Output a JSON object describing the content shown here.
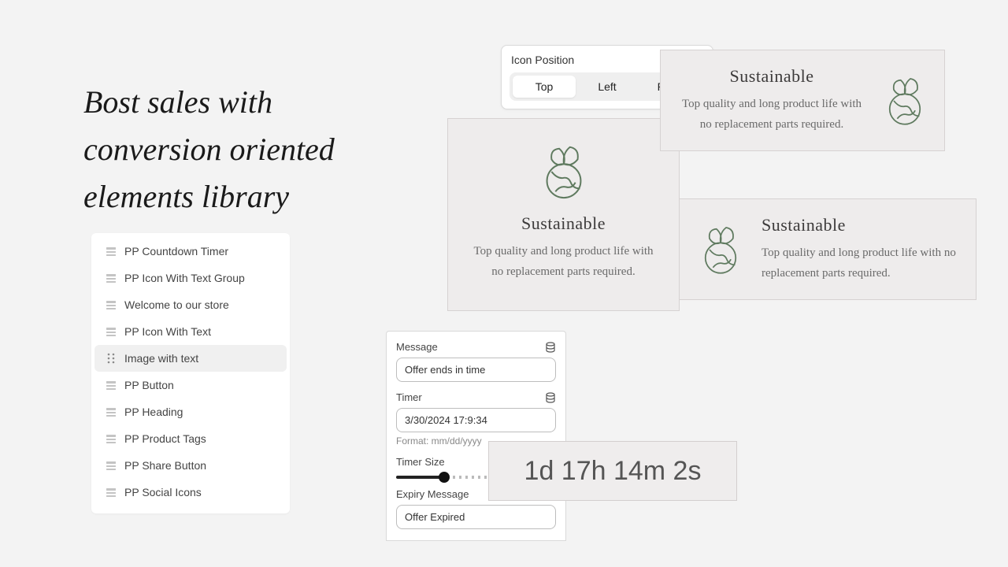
{
  "headline": "Bost sales with conversion oriented elements library",
  "elements": [
    {
      "label": "PP Countdown Timer",
      "active": false,
      "drag": false
    },
    {
      "label": "PP Icon With Text Group",
      "active": false,
      "drag": false
    },
    {
      "label": "Welcome to our store",
      "active": false,
      "drag": false
    },
    {
      "label": "PP Icon With Text",
      "active": false,
      "drag": false
    },
    {
      "label": "Image with text",
      "active": true,
      "drag": true
    },
    {
      "label": "PP Button",
      "active": false,
      "drag": false
    },
    {
      "label": "PP Heading",
      "active": false,
      "drag": false
    },
    {
      "label": "PP Product Tags",
      "active": false,
      "drag": false
    },
    {
      "label": "PP Share Button",
      "active": false,
      "drag": false
    },
    {
      "label": "PP Social Icons",
      "active": false,
      "drag": false
    }
  ],
  "icon_position": {
    "label": "Icon Position",
    "options": [
      "Top",
      "Left",
      "Right"
    ],
    "selected": 0
  },
  "card": {
    "title": "Sustainable",
    "body": "Top quality and long product life with no replacement parts required."
  },
  "form": {
    "message_label": "Message",
    "message_value": "Offer ends in time",
    "timer_label": "Timer",
    "timer_value": "3/30/2024 17:9:34",
    "timer_hint": "Format: mm/dd/yyyy",
    "size_label": "Timer Size",
    "expiry_label": "Expiry Message",
    "expiry_value": "Offer Expired"
  },
  "timer_display": "1d 17h 14m 2s"
}
